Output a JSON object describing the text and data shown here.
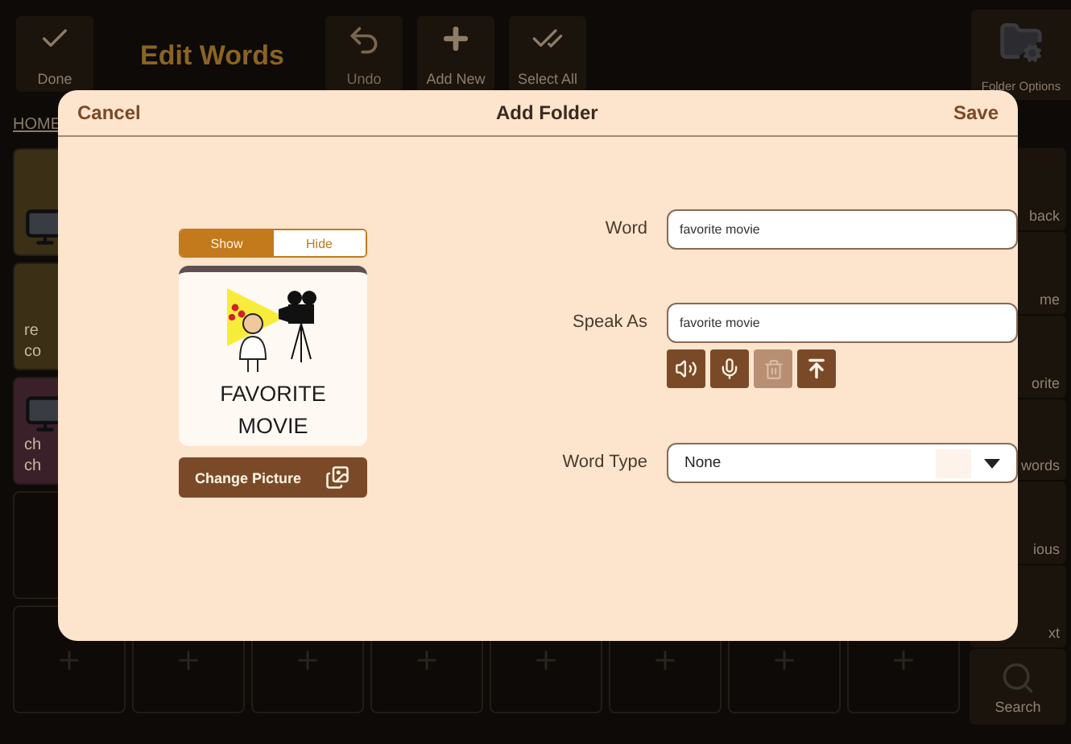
{
  "toolbar": {
    "done": {
      "label": "Done"
    },
    "title": "Edit Words",
    "actions": [
      {
        "kind": "undo",
        "label": "Undo",
        "disabled": true
      },
      {
        "kind": "add",
        "label": "Add New",
        "disabled": false
      },
      {
        "kind": "select",
        "label": "Select All",
        "disabled": false
      }
    ],
    "folder_options": {
      "label": "Folder Options"
    }
  },
  "breadcrumb": "HOME",
  "tiles": [
    {
      "kind": "picture",
      "color": "#3b3016"
    },
    {
      "kind": "text",
      "lines": [
        "re",
        "co"
      ],
      "color": "#3b3016"
    },
    {
      "kind": "picture",
      "lines": [
        "ch",
        "ch"
      ],
      "color": "#3a2129"
    }
  ],
  "sidebar": [
    {
      "label": "back"
    },
    {
      "label": "me"
    },
    {
      "label": "orite"
    },
    {
      "label": "words"
    },
    {
      "label": "ious"
    },
    {
      "label": "xt"
    },
    {
      "label": "Search",
      "kind": "search"
    }
  ],
  "dialog": {
    "title": "Add Folder",
    "cancel": "Cancel",
    "save": "Save",
    "visibility": [
      {
        "label": "Show",
        "selected": true
      },
      {
        "label": "Hide",
        "selected": false
      }
    ],
    "caption": "FAVORITE MOVIE",
    "change_picture": "Change Picture",
    "fields": [
      {
        "label": "Word",
        "value": "favorite movie"
      },
      {
        "label": "Speak As",
        "value": "favorite movie",
        "audio_buttons": [
          {
            "kind": "speak",
            "disabled": false
          },
          {
            "kind": "record",
            "disabled": false
          },
          {
            "kind": "delete",
            "disabled": true
          },
          {
            "kind": "upload",
            "disabled": false
          }
        ]
      },
      {
        "label": "Word Type",
        "value": "None",
        "kind": "select"
      }
    ]
  }
}
